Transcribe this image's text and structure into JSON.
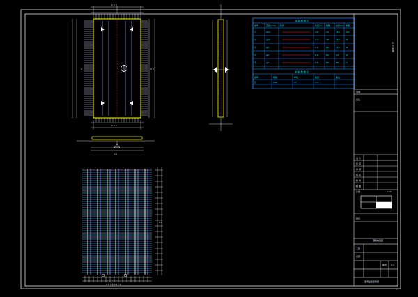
{
  "colors": {
    "background": "#000000",
    "frame": "#ffffff",
    "table_line": "#1e8fff",
    "dimension": "#f0f0f0",
    "outline": "#ffff00",
    "rebar": "#b0b0ff",
    "rebar_alt": "#30e0ff",
    "centerline": "#ff2020"
  },
  "elevation": {
    "dim_top": "1 2 3",
    "dim_bottom": "1 2 3",
    "dim_right": "2 3",
    "label": "1"
  },
  "section": {
    "label": "1-1"
  },
  "plan": {
    "label": "2-2",
    "dim_bottom": "1 2 3 4 5 6 7 8"
  },
  "rebar_table": {
    "title": "钢 筋 明 细 表",
    "header": [
      "编号",
      "直径(mm)",
      "形式",
      "长度(m)",
      "根数",
      "总长(m)",
      "重量"
    ],
    "rows": [
      [
        "①",
        "φ12",
        "",
        "4.8",
        "24",
        "115",
        "102"
      ],
      [
        "②",
        "φ10",
        "",
        "2.4",
        "48",
        "115",
        "71"
      ],
      [
        "③",
        "φ8",
        "",
        "1.2",
        "96",
        "115",
        "45"
      ],
      [
        "④",
        "φ8",
        "",
        "0.9",
        "60",
        "54",
        "21"
      ],
      [
        "⑤",
        "φ6",
        "",
        "0.6",
        "80",
        "48",
        "11"
      ]
    ],
    "sub_title": "材 料 数 量 表",
    "footer_header": [
      "名称",
      "规格",
      "单位",
      "数量",
      "备注"
    ],
    "footer_row": [
      "砼",
      "C30",
      "m³",
      "2.4",
      ""
    ]
  },
  "title_block": {
    "vertical_text": "设 计 说 明",
    "note_1": "说明:",
    "note_2": "备注",
    "rows_label": [
      "设 计",
      "复 核",
      "审 核",
      "审 定",
      "校 对",
      "制 图"
    ],
    "scale_label": "比例",
    "scale_value": "1:50",
    "drawing_label": "图名",
    "drawing_title": "钢筋构造图",
    "project_label": "工程",
    "date_label": "日期",
    "sheet_label": "图号",
    "sheet_value": "S-1",
    "bottom_title": "涵洞盖板配筋图",
    "page_mark": "1"
  }
}
